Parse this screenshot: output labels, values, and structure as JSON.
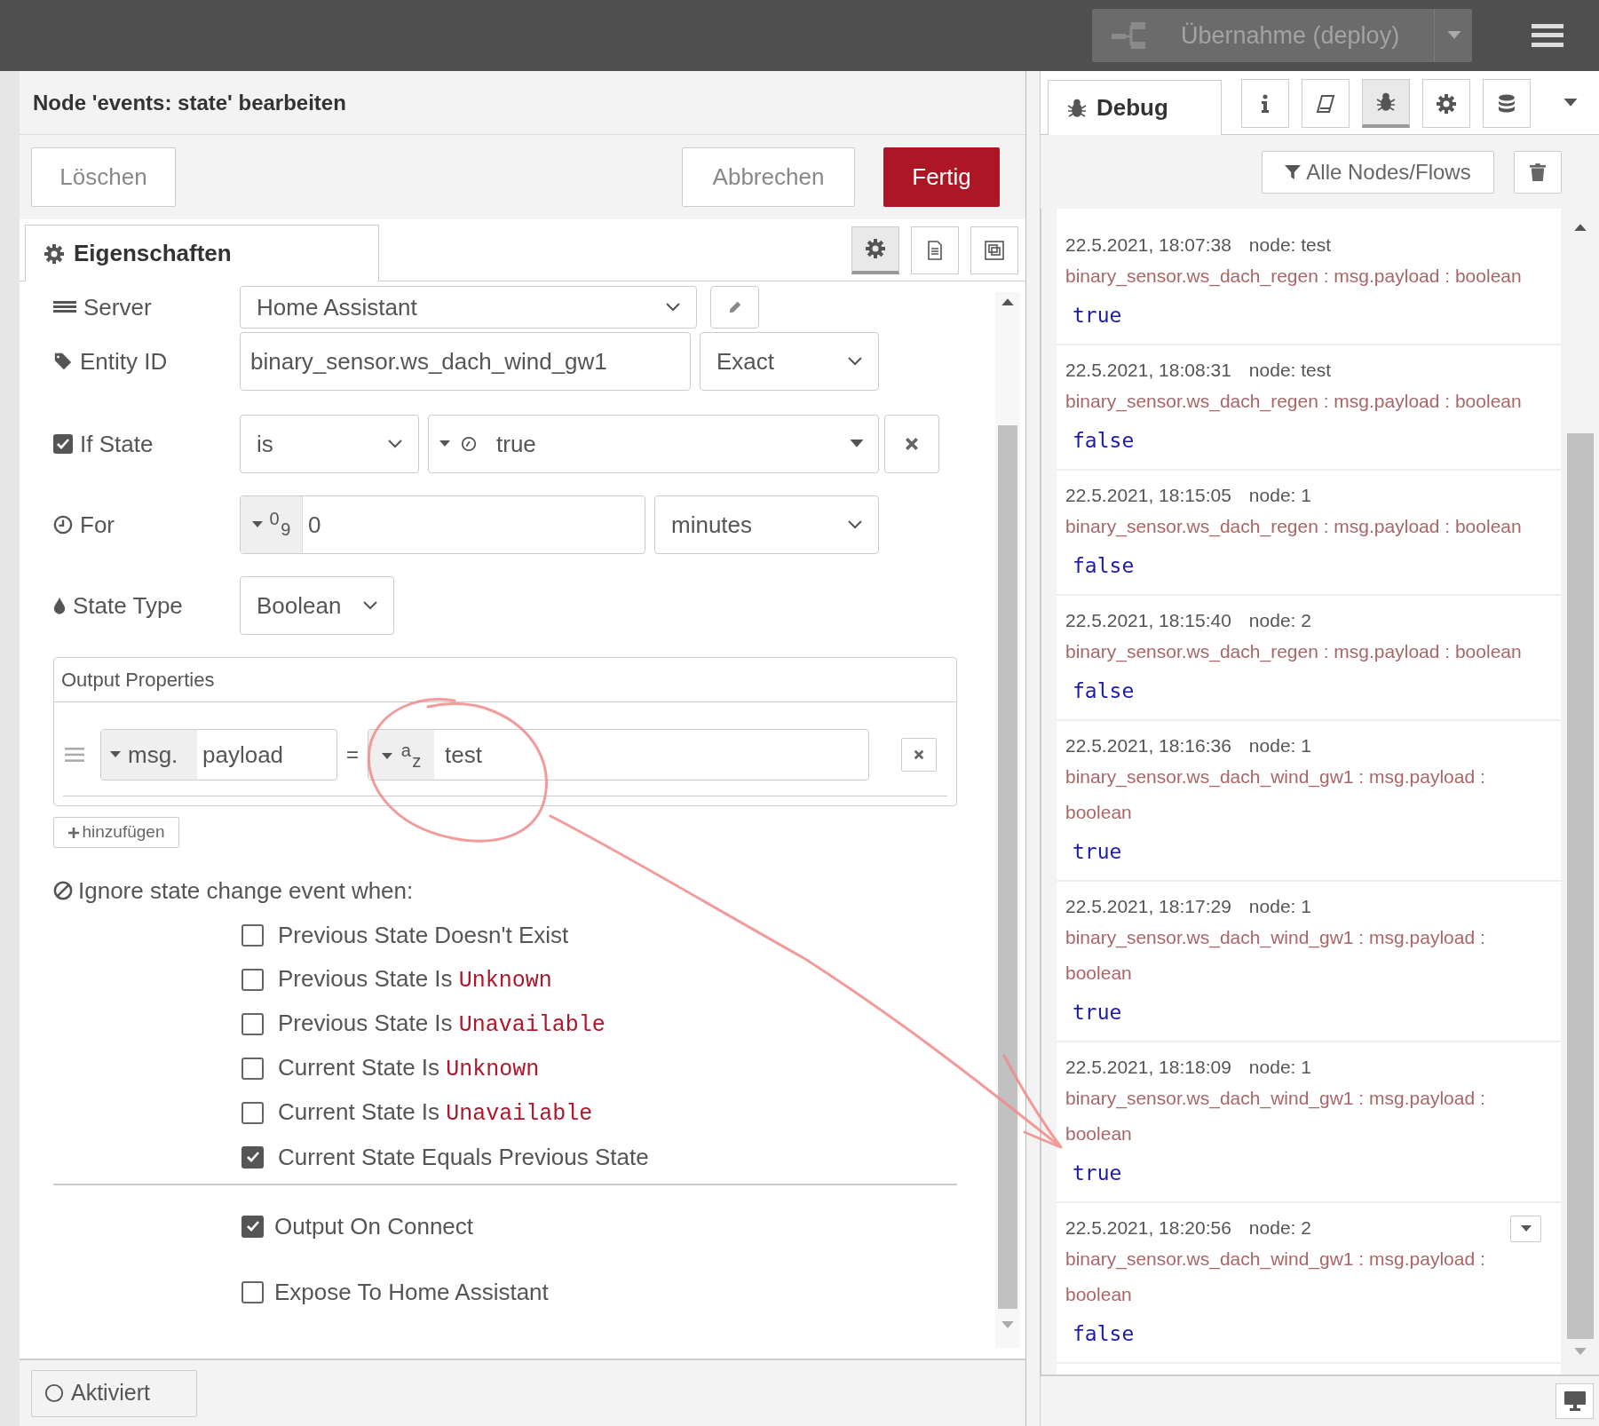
{
  "header": {
    "deploy_button": "Übernahme (deploy)"
  },
  "editor": {
    "title": "Node 'events: state' bearbeiten",
    "buttons": [
      {
        "label": "Löschen",
        "kind": "delete"
      },
      {
        "label": "Abbrechen",
        "kind": "cancel"
      },
      {
        "label": "Fertig",
        "kind": "done"
      }
    ],
    "tab": {
      "label": "Eigenschaften",
      "selected": true
    },
    "icon_tabs": [
      {
        "kind": "settings",
        "selected": true
      },
      {
        "kind": "description",
        "selected": false
      },
      {
        "kind": "appearance",
        "selected": false
      }
    ],
    "rows": [
      {
        "kind": "server",
        "label": "Server",
        "value": "Home Assistant"
      },
      {
        "kind": "entity",
        "label": "Entity ID",
        "value": "binary_sensor.ws_dach_wind_gw1",
        "match": "Exact"
      },
      {
        "kind": "if_state",
        "label": "If State",
        "checked": true,
        "operator": "is",
        "value": "true"
      },
      {
        "kind": "for",
        "label": "For",
        "type_marks": [
          "0",
          "9"
        ],
        "value": "0",
        "unit": "minutes"
      },
      {
        "kind": "state_type",
        "label": "State Type",
        "value": "Boolean"
      }
    ],
    "output_properties": {
      "title": "Output Properties",
      "rows": [
        {
          "prefix": "msg.",
          "property": "payload",
          "equals": "=",
          "type_marks": [
            "a",
            "z"
          ],
          "value": "test"
        }
      ],
      "add_button": "hinzufügen"
    },
    "ignore": {
      "heading": "Ignore state change event when:",
      "options": [
        {
          "label": "Previous State Doesn't Exist",
          "checked": false
        },
        {
          "label": "Previous State Is",
          "code": "Unknown",
          "checked": false
        },
        {
          "label": "Previous State Is",
          "code": "Unavailable",
          "checked": false
        },
        {
          "label": "Current State Is",
          "code": "Unknown",
          "checked": false
        },
        {
          "label": "Current State Is",
          "code": "Unavailable",
          "checked": false
        },
        {
          "label": "Current State Equals Previous State",
          "checked": true
        }
      ]
    },
    "options": [
      {
        "label": "Output On Connect",
        "checked": true
      },
      {
        "label": "Expose To Home Assistant",
        "checked": false
      }
    ],
    "footer": {
      "enabled_button": "Aktiviert"
    }
  },
  "sidebar": {
    "tab": {
      "label": "Debug",
      "selected": true
    },
    "icon_tabs": [
      {
        "kind": "info",
        "selected": false
      },
      {
        "kind": "book",
        "selected": false
      },
      {
        "kind": "debug",
        "selected": true
      },
      {
        "kind": "settings",
        "selected": false
      },
      {
        "kind": "database",
        "selected": false
      }
    ],
    "filter_button": "Alle Nodes/Flows",
    "messages": [
      {
        "time": "22.5.2021, 18:07:38",
        "node": "node: test",
        "topic": "binary_sensor.ws_dach_regen : msg.payload : boolean",
        "value": "true",
        "show_menu": false
      },
      {
        "time": "22.5.2021, 18:08:31",
        "node": "node: test",
        "topic": "binary_sensor.ws_dach_regen : msg.payload : boolean",
        "value": "false",
        "show_menu": false
      },
      {
        "time": "22.5.2021, 18:15:05",
        "node": "node: 1",
        "topic": "binary_sensor.ws_dach_regen : msg.payload : boolean",
        "value": "false",
        "show_menu": false
      },
      {
        "time": "22.5.2021, 18:15:40",
        "node": "node: 2",
        "topic": "binary_sensor.ws_dach_regen : msg.payload : boolean",
        "value": "false",
        "show_menu": false
      },
      {
        "time": "22.5.2021, 18:16:36",
        "node": "node: 1",
        "topic": "binary_sensor.ws_dach_wind_gw1 : msg.payload : boolean",
        "value": "true",
        "show_menu": false
      },
      {
        "time": "22.5.2021, 18:17:29",
        "node": "node: 1",
        "topic": "binary_sensor.ws_dach_wind_gw1 : msg.payload : boolean",
        "value": "true",
        "show_menu": false
      },
      {
        "time": "22.5.2021, 18:18:09",
        "node": "node: 1",
        "topic": "binary_sensor.ws_dach_wind_gw1 : msg.payload : boolean",
        "value": "true",
        "show_menu": false
      },
      {
        "time": "22.5.2021, 18:20:56",
        "node": "node: 2",
        "topic": "binary_sensor.ws_dach_wind_gw1 : msg.payload : boolean",
        "value": "false",
        "show_menu": true
      }
    ]
  }
}
